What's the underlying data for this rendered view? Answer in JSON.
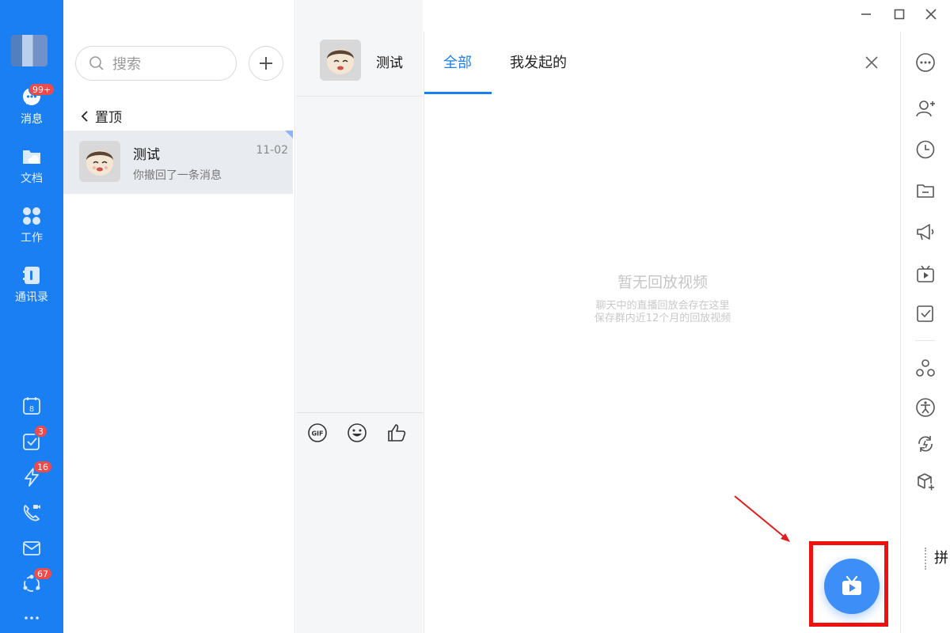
{
  "nav": {
    "items": [
      {
        "label": "消息",
        "icon": "chat-bubble-icon",
        "badge": "99+"
      },
      {
        "label": "文档",
        "icon": "cloud-folder-icon"
      },
      {
        "label": "工作",
        "icon": "grid-apps-icon"
      },
      {
        "label": "通讯录",
        "icon": "contacts-book-icon"
      }
    ],
    "bottom": [
      {
        "icon": "calendar-icon",
        "value": "8"
      },
      {
        "icon": "todo-check-icon",
        "badge": "3"
      },
      {
        "icon": "lightning-icon",
        "badge": "16"
      },
      {
        "icon": "phone-video-icon"
      },
      {
        "icon": "mail-icon"
      },
      {
        "icon": "network-icon",
        "badge": "67"
      },
      {
        "icon": "more-dots-icon"
      }
    ]
  },
  "list": {
    "search_placeholder": "搜索",
    "pinned_label": "置顶",
    "chats": [
      {
        "name": "测试",
        "time": "11-02",
        "preview": "你撤回了一条消息"
      }
    ]
  },
  "chat": {
    "title": "测试",
    "tools": [
      "gif-icon",
      "emoji-icon",
      "thumbs-up-icon"
    ]
  },
  "panel": {
    "tabs": [
      "全部",
      "我发起的"
    ],
    "empty_title": "暂无回放视频",
    "empty_lines": [
      "聊天中的直播回放会存在这里",
      "保存群内近12个月的回放视频"
    ]
  },
  "ime": {
    "label": "拼"
  },
  "colors": {
    "brand": "#1a7ff2",
    "badge": "#f04a4a",
    "highlight": "#ee1111"
  }
}
